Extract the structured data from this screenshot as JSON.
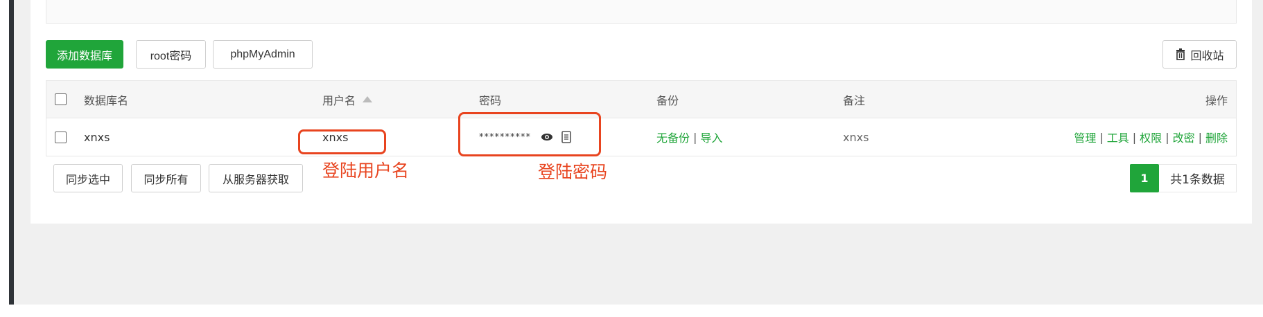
{
  "toolbar": {
    "add_db_label": "添加数据库",
    "root_pw_label": "root密码",
    "phpmyadmin_label": "phpMyAdmin",
    "recycle_label": "回收站"
  },
  "table": {
    "headers": {
      "db_name": "数据库名",
      "username": "用户名",
      "password": "密码",
      "backup": "备份",
      "remark": "备注",
      "actions": "操作"
    },
    "rows": [
      {
        "db_name": "xnxs",
        "username": "xnxs",
        "password": "**********",
        "backup_none": "无备份",
        "backup_import": "导入",
        "remark": "xnxs",
        "actions": [
          "管理",
          "工具",
          "权限",
          "改密",
          "删除"
        ]
      }
    ]
  },
  "bottom_buttons": {
    "sync_selected": "同步选中",
    "sync_all": "同步所有",
    "fetch_server": "从服务器获取"
  },
  "annotations": {
    "username_label": "登陆用户名",
    "password_label": "登陆密码"
  },
  "pagination": {
    "current_page": "1",
    "total_text": "共1条数据"
  },
  "colors": {
    "accent_green": "#20a53a",
    "annotation_red": "#e8441f"
  }
}
